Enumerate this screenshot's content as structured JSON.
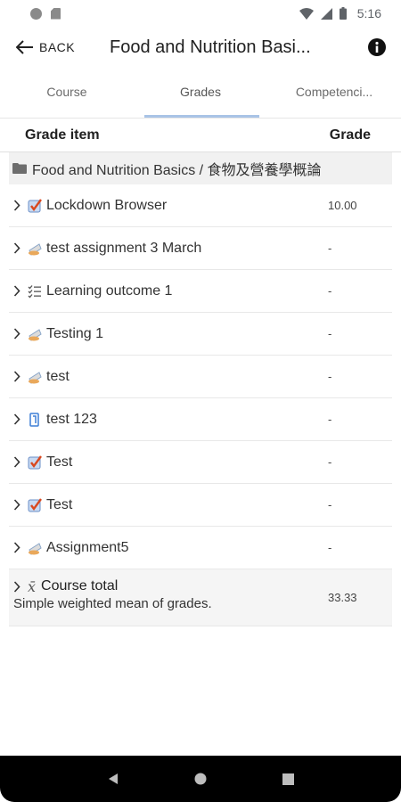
{
  "status": {
    "time": "5:16"
  },
  "header": {
    "back_label": "BACK",
    "title": "Food and Nutrition Basi..."
  },
  "tabs": [
    {
      "label": "Course"
    },
    {
      "label": "Grades"
    },
    {
      "label": "Competenci..."
    }
  ],
  "table": {
    "col_item": "Grade item",
    "col_grade": "Grade"
  },
  "category": {
    "name": "Food and Nutrition Basics / 食物及營養學概論"
  },
  "items": [
    {
      "name": "Lockdown Browser",
      "grade": "10.00",
      "icon": "quiz-icon"
    },
    {
      "name": "test assignment 3 March",
      "grade": "-",
      "icon": "assignment-icon"
    },
    {
      "name": "Learning outcome 1",
      "grade": "-",
      "icon": "outcome-icon"
    },
    {
      "name": "Testing 1",
      "grade": "-",
      "icon": "assignment-icon"
    },
    {
      "name": "test",
      "grade": "-",
      "icon": "assignment-icon"
    },
    {
      "name": "test 123",
      "grade": "-",
      "icon": "turnitin-icon"
    },
    {
      "name": "Test",
      "grade": "-",
      "icon": "quiz-icon"
    },
    {
      "name": "Test",
      "grade": "-",
      "icon": "quiz-icon"
    },
    {
      "name": "Assignment5",
      "grade": "-",
      "icon": "assignment-icon"
    }
  ],
  "total": {
    "name": "Course total",
    "description": "Simple weighted mean of grades.",
    "grade": "33.33"
  }
}
